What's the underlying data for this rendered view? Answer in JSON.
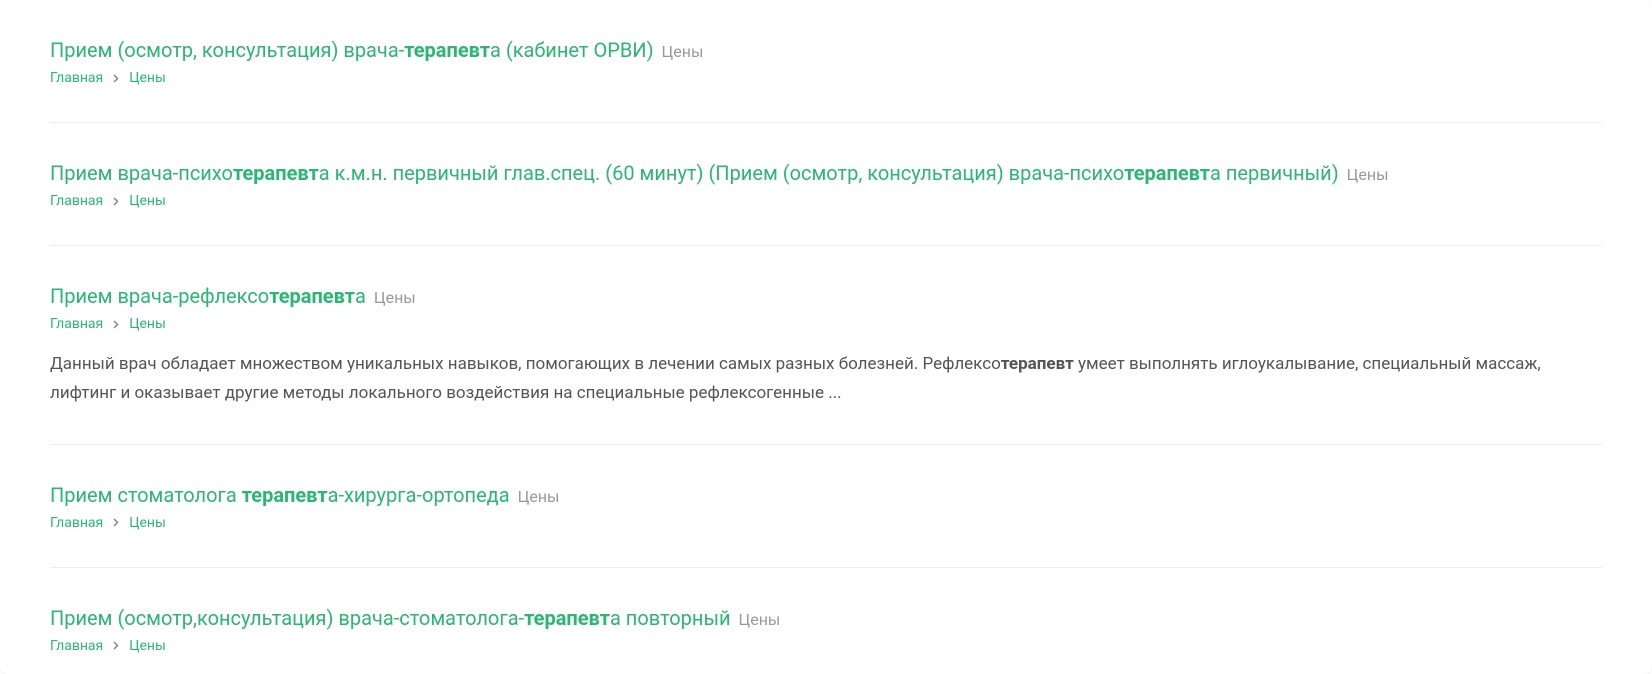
{
  "category_label": "Цены",
  "breadcrumb": {
    "home": "Главная",
    "page": "Цены"
  },
  "results": [
    {
      "title_parts": [
        "Прием (осмотр, консультация) врача-",
        "терапевт",
        "а (кабинет ОРВИ)"
      ],
      "snippet_parts": null
    },
    {
      "title_parts": [
        "Прием врача-психо",
        "терапевт",
        "а к.м.н. первичный глав.спец. (60 минут) (Прием (осмотр, консультация) врача-психо",
        "терапевт",
        "а первичный)"
      ],
      "snippet_parts": null
    },
    {
      "title_parts": [
        "Прием врача-рефлексо",
        "терапевт",
        "а"
      ],
      "snippet_parts": [
        "Данный врач обладает множеством уникальных навыков, помогающих в лечении самых разных болезней. Рефлексо",
        "терапевт",
        " умеет выполнять иглоукалывание, специальный массаж, лифтинг и оказывает другие методы локального воздействия на специальные рефлексогенные ..."
      ]
    },
    {
      "title_parts": [
        "Прием стоматолога ",
        "терапевт",
        "а-хирурга-ортопеда"
      ],
      "snippet_parts": null
    },
    {
      "title_parts": [
        "Прием (осмотр,консультация) врача-стоматолога-",
        "терапевт",
        "а повторный"
      ],
      "snippet_parts": null
    }
  ]
}
